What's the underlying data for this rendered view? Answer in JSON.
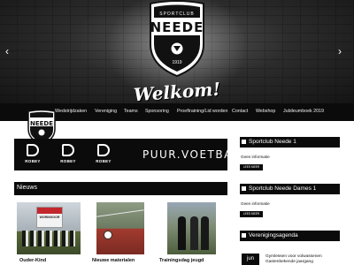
{
  "hero": {
    "club_top": "SPORTCLUB",
    "club_name": "NEEDE",
    "club_year": "1919",
    "welcome": "Welkom!",
    "prev_arrow": "‹",
    "next_arrow": "›"
  },
  "nav": {
    "items": [
      "Wedstrijdzaken",
      "Vereniging",
      "Teams",
      "Sponsoring",
      "Proeftraining/Lid worden",
      "Contact",
      "Webshop",
      "Jubileumboek 2019"
    ]
  },
  "badge": {
    "name": "NEEDE"
  },
  "banner": {
    "logos": [
      "ROBEY",
      "ROBEY",
      "ROBEY"
    ],
    "slogan": "PUUR.VOETBAL."
  },
  "news": {
    "title": "Nieuws",
    "board_text": "WORINGOOR",
    "captions": [
      "Ouder-Kind",
      "Nieuwe materialen",
      "Trainingsdag jeugd"
    ]
  },
  "sidebar": {
    "widgets": [
      {
        "title": "Sportclub Neede 1",
        "text": "Geen informatie",
        "button": "LEES MEER"
      },
      {
        "title": "Sportclub Neede Dames 1",
        "text": "Geen informatie",
        "button": "LEES MEER"
      }
    ],
    "agenda": {
      "title": "Verenigingsagenda",
      "month": "jun",
      "text_line1": "Gymlessen voor volwassenen",
      "text_line2": "Gastenbekende jaargang"
    }
  },
  "colors": {
    "bar": "#0b0b0b",
    "text": "#111111",
    "background": "#ffffff"
  }
}
